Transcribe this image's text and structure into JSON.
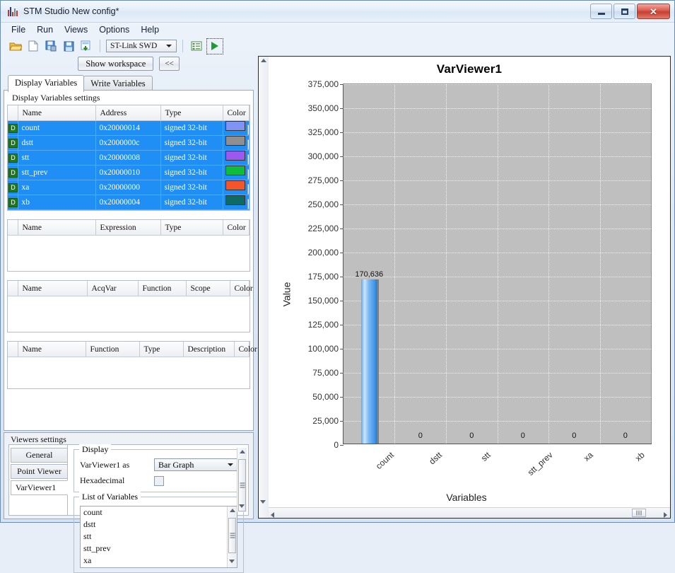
{
  "window": {
    "title": "STM Studio New config*",
    "icon": "bar-chart-icon",
    "buttons": {
      "minimize": "—",
      "maximize": "□",
      "close": "✕"
    }
  },
  "menu": {
    "items": [
      "File",
      "Run",
      "Views",
      "Options",
      "Help"
    ]
  },
  "toolbar": {
    "icons": [
      {
        "name": "open-folder-icon",
        "glyph": "📂"
      },
      {
        "name": "new-file-icon",
        "glyph": "🗎"
      },
      {
        "name": "save-as-icon",
        "glyph": "💾"
      },
      {
        "name": "save-icon",
        "glyph": "💾"
      },
      {
        "name": "export-icon",
        "glyph": "🖹"
      }
    ],
    "target_select": {
      "value": "ST-Link SWD"
    },
    "settings_icon": "settings-list-icon",
    "run_button": "run-icon"
  },
  "left": {
    "show_workspace_label": "Show workspace",
    "collapse_label": "<<",
    "tabs": [
      {
        "label": "Display Variables",
        "active": true
      },
      {
        "label": "Write Variables",
        "active": false
      }
    ],
    "settings_group_title": "Display Variables settings",
    "variables_table": {
      "columns": [
        "",
        "Name",
        "Address",
        "Type",
        "Color"
      ],
      "rows": [
        {
          "badge": "D",
          "name": "count",
          "address": "0x20000014",
          "type": "signed 32-bit",
          "color": "#8094f5",
          "dots": "..."
        },
        {
          "badge": "D",
          "name": "dstt",
          "address": "0x2000000c",
          "type": "signed 32-bit",
          "color": "#8f8f8f",
          "dots": "..."
        },
        {
          "badge": "D",
          "name": "stt",
          "address": "0x20000008",
          "type": "signed 32-bit",
          "color": "#9b59f0",
          "dots": "..."
        },
        {
          "badge": "D",
          "name": "stt_prev",
          "address": "0x20000010",
          "type": "signed 32-bit",
          "color": "#0fbd3c",
          "dots": "..."
        },
        {
          "badge": "D",
          "name": "xa",
          "address": "0x20000000",
          "type": "signed 32-bit",
          "color": "#f4562c",
          "dots": "..."
        },
        {
          "badge": "D",
          "name": "xb",
          "address": "0x20000004",
          "type": "signed 32-bit",
          "color": "#0c6b63",
          "dots": "..."
        }
      ]
    },
    "expressions_table": {
      "columns": [
        "",
        "Name",
        "Expression",
        "Type",
        "Color"
      ],
      "rows": []
    },
    "acq_table": {
      "columns": [
        "",
        "Name",
        "AcqVar",
        "Function",
        "Scope",
        "Color"
      ],
      "rows": []
    },
    "functions_table": {
      "columns": [
        "",
        "Name",
        "Function",
        "Type",
        "Description",
        "Color"
      ],
      "rows": []
    }
  },
  "viewers": {
    "group_title": "Viewers settings",
    "tabs": [
      {
        "label": "General",
        "active": false
      },
      {
        "label": "Point Viewer",
        "active": false
      },
      {
        "label": "VarViewer1",
        "active": true
      }
    ],
    "display_group": "Display",
    "display_as_label": "VarViewer1 as",
    "display_as_value": "Bar Graph",
    "hexadecimal_label": "Hexadecimal",
    "hexadecimal_checked": false,
    "list_group": "List of Variables",
    "variables": [
      "count",
      "dstt",
      "stt",
      "stt_prev",
      "xa"
    ]
  },
  "chart_data": {
    "type": "bar",
    "title": "VarViewer1",
    "xlabel": "Variables",
    "ylabel": "Value",
    "categories": [
      "count",
      "dstt",
      "stt",
      "stt_prev",
      "xa",
      "xb"
    ],
    "values": [
      170636,
      0,
      0,
      0,
      0,
      0
    ],
    "value_labels": [
      "170,636",
      "0",
      "0",
      "0",
      "0",
      "0"
    ],
    "ylim": [
      0,
      375000
    ],
    "ytick_step": 25000,
    "yticks": [
      0,
      25000,
      50000,
      75000,
      100000,
      125000,
      150000,
      175000,
      200000,
      225000,
      250000,
      275000,
      300000,
      325000,
      350000,
      375000
    ],
    "ytick_labels": [
      "0",
      "25,000",
      "50,000",
      "75,000",
      "100,000",
      "125,000",
      "150,000",
      "175,000",
      "200,000",
      "225,000",
      "250,000",
      "275,000",
      "300,000",
      "325,000",
      "350,000",
      "375,000"
    ],
    "grid": true,
    "legend": false,
    "plot_bg": "#bfbfbf",
    "bar_color": "#5ba7ef"
  }
}
